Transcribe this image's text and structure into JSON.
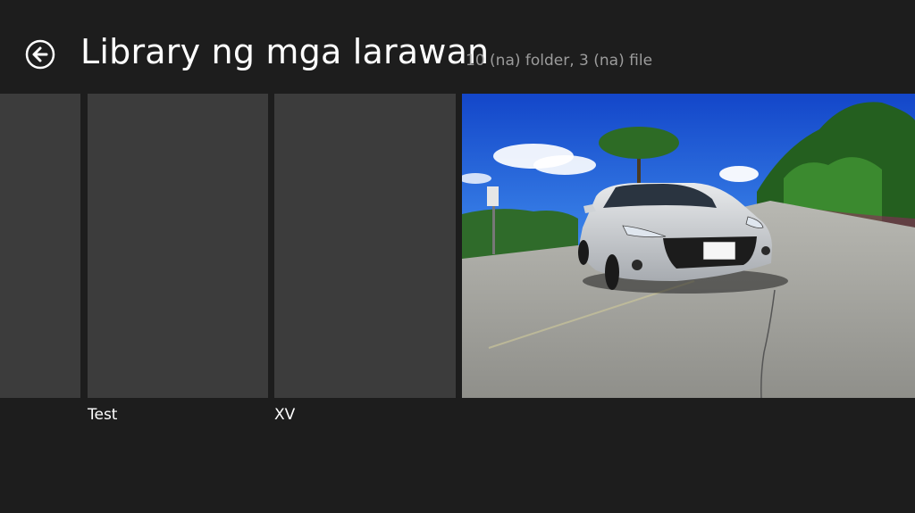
{
  "header": {
    "title": "Library ng mga larawan",
    "subtitle": "10 (na) folder, 3 (na) file",
    "back_icon": "back-arrow-circle-icon"
  },
  "tiles": [
    {
      "label": "",
      "type": "folder"
    },
    {
      "label": "Test",
      "type": "folder"
    },
    {
      "label": "XV",
      "type": "folder"
    },
    {
      "label": "",
      "type": "photo",
      "photo_subject": "silver sports car on road"
    }
  ],
  "colors": {
    "background": "#1d1d1d",
    "tile": "#3c3c3c",
    "subtitle": "#9c9c9c"
  }
}
